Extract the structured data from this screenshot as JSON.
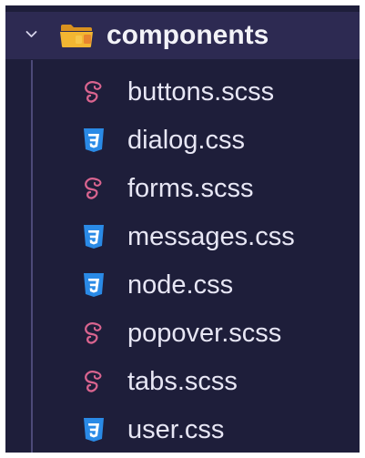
{
  "explorer": {
    "folder": {
      "name": "components",
      "icon": "folder-icon",
      "expanded": true
    },
    "files": [
      {
        "name": "buttons.scss",
        "icon": "sass-icon"
      },
      {
        "name": "dialog.css",
        "icon": "css3-icon"
      },
      {
        "name": "forms.scss",
        "icon": "sass-icon"
      },
      {
        "name": "messages.css",
        "icon": "css3-icon"
      },
      {
        "name": "node.css",
        "icon": "css3-icon"
      },
      {
        "name": "popover.scss",
        "icon": "sass-icon"
      },
      {
        "name": "tabs.scss",
        "icon": "sass-icon"
      },
      {
        "name": "user.css",
        "icon": "css3-icon"
      }
    ]
  },
  "colors": {
    "background": "#1e1e3a",
    "folder_row_highlight": "#2d2a52",
    "text": "#e7e6f4",
    "sass_pink": "#d9648f",
    "css_blue": "#2a8ae6",
    "folder_yellow": "#f2b632"
  }
}
